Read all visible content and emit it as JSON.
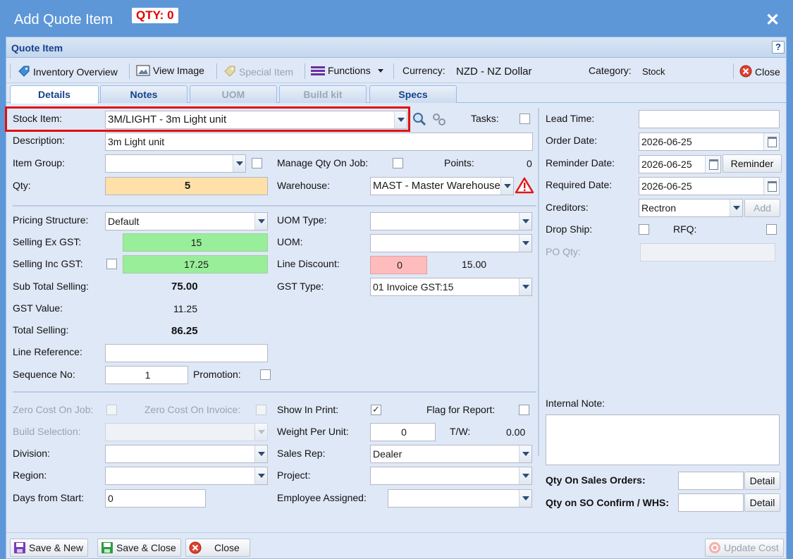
{
  "window": {
    "title": "Add Quote Item",
    "qty_badge": "QTY: 0",
    "close_glyph": "✕"
  },
  "panel": {
    "title": "Quote Item",
    "help": "?"
  },
  "toolbar": {
    "inventory_overview": "Inventory Overview",
    "view_image": "View Image",
    "special_item": "Special Item",
    "functions": "Functions",
    "currency_label": "Currency:",
    "currency_value": "NZD - NZ Dollar",
    "category_label": "Category:",
    "category_value": "Stock",
    "close": "Close"
  },
  "tabs": [
    "Details",
    "Notes",
    "UOM",
    "Build kit",
    "Specs"
  ],
  "left": {
    "stock_item_label": "Stock Item:",
    "stock_item_value": "3M/LIGHT - 3m Light unit",
    "tasks_label": "Tasks:",
    "description_label": "Description:",
    "description_value": "3m Light unit",
    "item_group_label": "Item Group:",
    "item_group_value": "",
    "manage_qty_label": "Manage Qty On Job:",
    "points_label": "Points:",
    "points_value": "0",
    "qty_label": "Qty:",
    "qty_value": "5",
    "warehouse_label": "Warehouse:",
    "warehouse_value": "MAST - Master Warehouse",
    "pricing_structure_label": "Pricing Structure:",
    "pricing_structure_value": "Default",
    "uom_type_label": "UOM Type:",
    "selling_ex_gst_label": "Selling Ex GST:",
    "selling_ex_gst_value": "15",
    "uom_label": "UOM:",
    "selling_inc_gst_label": "Selling Inc GST:",
    "selling_inc_gst_value": "17.25",
    "line_discount_label": "Line Discount:",
    "line_discount_value": "0",
    "line_discount_amount": "15.00",
    "sub_total_label": "Sub Total Selling:",
    "sub_total_value": "75.00",
    "gst_type_label": "GST Type:",
    "gst_type_value": "01 Invoice GST:15",
    "gst_value_label": "GST Value:",
    "gst_value": "11.25",
    "total_selling_label": "Total Selling:",
    "total_selling_value": "86.25",
    "line_reference_label": "Line Reference:",
    "sequence_no_label": "Sequence No:",
    "sequence_no_value": "1",
    "promotion_label": "Promotion:",
    "zero_cost_job_label": "Zero Cost On Job:",
    "zero_cost_invoice_label": "Zero Cost On Invoice:",
    "show_in_print_label": "Show In Print:",
    "flag_report_label": "Flag for Report:",
    "build_selection_label": "Build Selection:",
    "weight_per_unit_label": "Weight Per Unit:",
    "weight_per_unit_value": "0",
    "tw_label": "T/W:",
    "tw_value": "0.00",
    "division_label": "Division:",
    "sales_rep_label": "Sales Rep:",
    "sales_rep_value": "Dealer",
    "region_label": "Region:",
    "project_label": "Project:",
    "days_from_start_label": "Days from Start:",
    "days_from_start_value": "0",
    "employee_assigned_label": "Employee Assigned:"
  },
  "right": {
    "lead_time_label": "Lead Time:",
    "order_date_label": "Order Date:",
    "order_date_value": "2026-06-25",
    "reminder_date_label": "Reminder Date:",
    "reminder_date_value": "2026-06-25",
    "reminder_button": "Reminder",
    "required_date_label": "Required Date:",
    "required_date_value": "2026-06-25",
    "creditors_label": "Creditors:",
    "creditors_value": "Rectron",
    "add_button": "Add",
    "drop_ship_label": "Drop Ship:",
    "rfq_label": "RFQ:",
    "po_qty_label": "PO Qty:",
    "internal_note_label": "Internal Note:",
    "qty_on_so_label": "Qty On Sales Orders:",
    "qty_on_so_confirm_label": "Qty on SO Confirm / WHS:",
    "detail_button": "Detail"
  },
  "footer": {
    "save_new": "Save & New",
    "save_close": "Save & Close",
    "close": "Close",
    "update_cost": "Update Cost"
  },
  "colors": {
    "qty_field": "#ffe0a8",
    "selling_field": "#99ee99",
    "discount_field": "#ffbcbc",
    "title_bar": "#5d97d8",
    "highlight_box": "#e01010"
  }
}
